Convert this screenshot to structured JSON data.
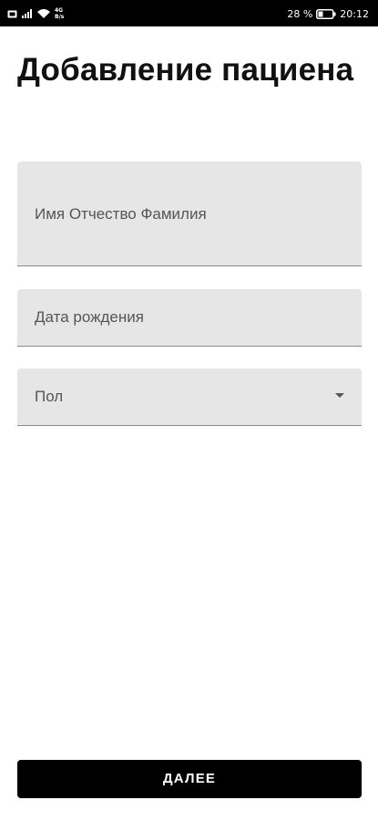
{
  "status_bar": {
    "network_top": "4G",
    "network_bottom": "B/s",
    "battery_percent": "28 %",
    "time": "20:12",
    "icons": [
      "sim-icon",
      "signal-icon",
      "wifi-icon",
      "battery-icon"
    ]
  },
  "page": {
    "title": "Добавление пациена"
  },
  "form": {
    "name_placeholder": "Имя Отчество Фамилия",
    "birthdate_placeholder": "Дата рождения",
    "gender_placeholder": "Пол",
    "gender_icon": "chevron-down-icon"
  },
  "actions": {
    "next_label": "ДАЛЕЕ"
  },
  "colors": {
    "status_bar": "#000000",
    "field_background": "#e6e6e6",
    "button_background": "#000000",
    "button_text": "#ffffff"
  }
}
